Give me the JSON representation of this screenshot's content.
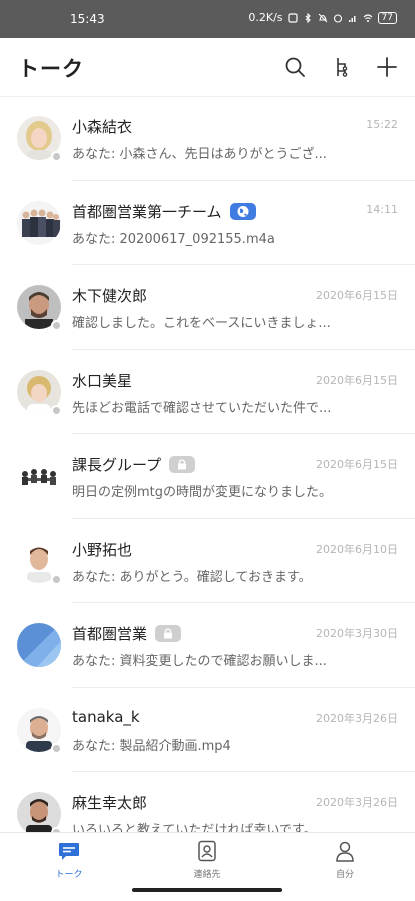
{
  "status_bar": {
    "time": "15:43",
    "speed": "0.2K/s",
    "battery": "77"
  },
  "header": {
    "title": "トーク",
    "icons": [
      "search-icon",
      "branch-icon",
      "add-icon"
    ]
  },
  "colors": {
    "accent": "#2f6fd8",
    "status_bar_bg": "#5b5b5b",
    "badge_blue": "#3f7be0",
    "badge_gray": "#cfcfcf"
  },
  "chats": [
    {
      "name": "小森結衣",
      "time": "15:22",
      "preview": "あなた: 小森さん、先日はありがとうござ...",
      "badge": ""
    },
    {
      "name": "首都圏営業第一チーム",
      "time": "14:11",
      "preview": "あなた: 20200617_092155.m4a",
      "badge": "globe"
    },
    {
      "name": "木下健次郎",
      "time": "2020年6月15日",
      "preview": "確認しました。これをベースにいきましょ...",
      "badge": ""
    },
    {
      "name": "水口美星",
      "time": "2020年6月15日",
      "preview": "先ほどお電話で確認させていただいた件で...",
      "badge": ""
    },
    {
      "name": "課長グループ",
      "time": "2020年6月15日",
      "preview": "明日の定例mtgの時間が変更になりました。",
      "badge": "lock"
    },
    {
      "name": "小野拓也",
      "time": "2020年6月10日",
      "preview": "あなた: ありがとう。確認しておきます。",
      "badge": ""
    },
    {
      "name": "首都圏営業",
      "time": "2020年3月30日",
      "preview": "あなた: 資料変更したので確認お願いしま...",
      "badge": "lock"
    },
    {
      "name": "tanaka_k",
      "time": "2020年3月26日",
      "preview": "あなた: 製品紹介動画.mp4",
      "badge": ""
    },
    {
      "name": "麻生幸太郎",
      "time": "2020年3月26日",
      "preview": "いろいろと教えていただければ幸いです。",
      "badge": ""
    }
  ],
  "tabs": [
    {
      "label": "トーク",
      "icon": "chat-icon",
      "active": true
    },
    {
      "label": "連絡先",
      "icon": "contacts-icon",
      "active": false
    },
    {
      "label": "自分",
      "icon": "profile-icon",
      "active": false
    }
  ]
}
